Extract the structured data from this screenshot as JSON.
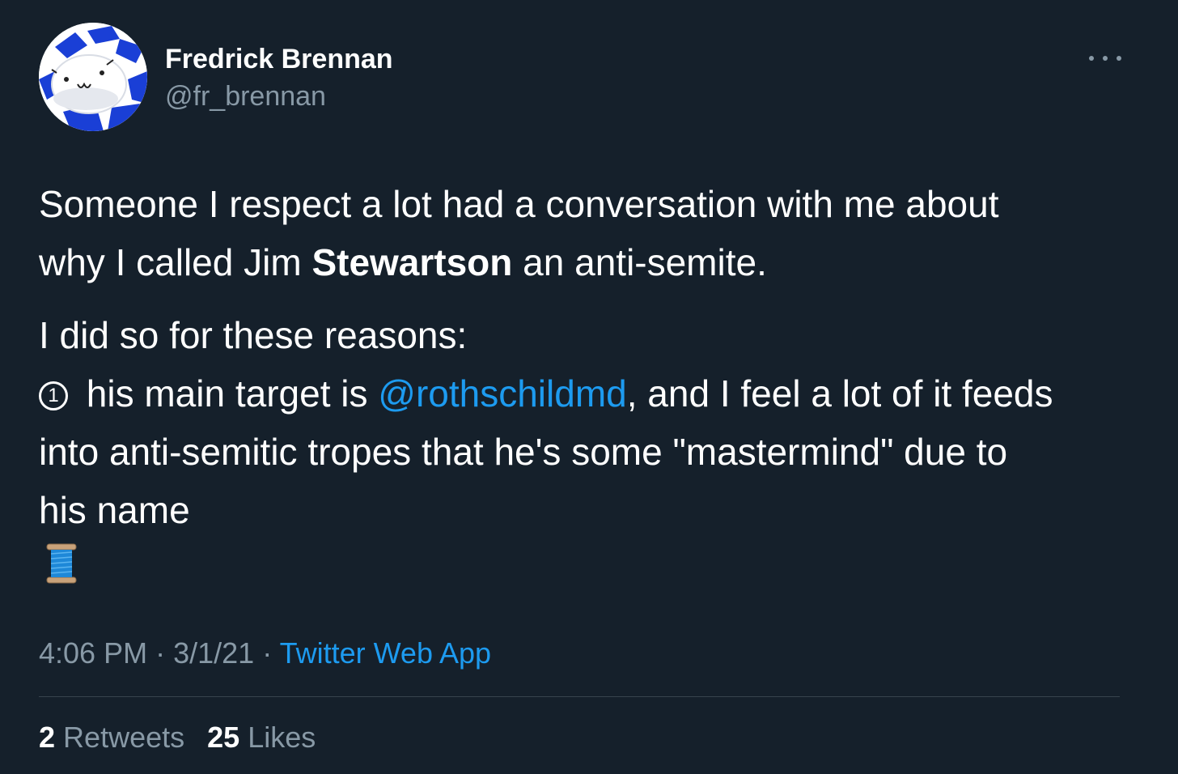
{
  "author": {
    "name": "Fredrick Brennan",
    "handle": "@fr_brennan",
    "avatar_icon": "cartoon-face-avatar"
  },
  "more_icon": "more-options-icon",
  "tweet": {
    "line1": "Someone I respect a lot had a conversation with me about",
    "line2_before": "why I called Jim ",
    "line2_bold": "Stewartson",
    "line2_after": " an anti-semite.",
    "line3": "I did so for these reasons:",
    "bullet_number": "1",
    "line4_before": " his main target is ",
    "mention": "@rothschildmd",
    "line4_after": ", and I feel a lot of it feeds",
    "line5": "into anti-semitic tropes that he's some \"mastermind\" due to",
    "line6": "his name",
    "emoji_icon": "thread-spool-icon"
  },
  "meta": {
    "time": "4:06 PM",
    "separator": "·",
    "date": "3/1/21",
    "source": "Twitter Web App"
  },
  "stats": {
    "retweets_count": "2",
    "retweets_label": "Retweets",
    "likes_count": "25",
    "likes_label": "Likes"
  },
  "colors": {
    "background": "#15202b",
    "primary_text": "#ffffff",
    "secondary_text": "#8899a6",
    "link": "#1d9bf0",
    "divider": "#38444d"
  }
}
